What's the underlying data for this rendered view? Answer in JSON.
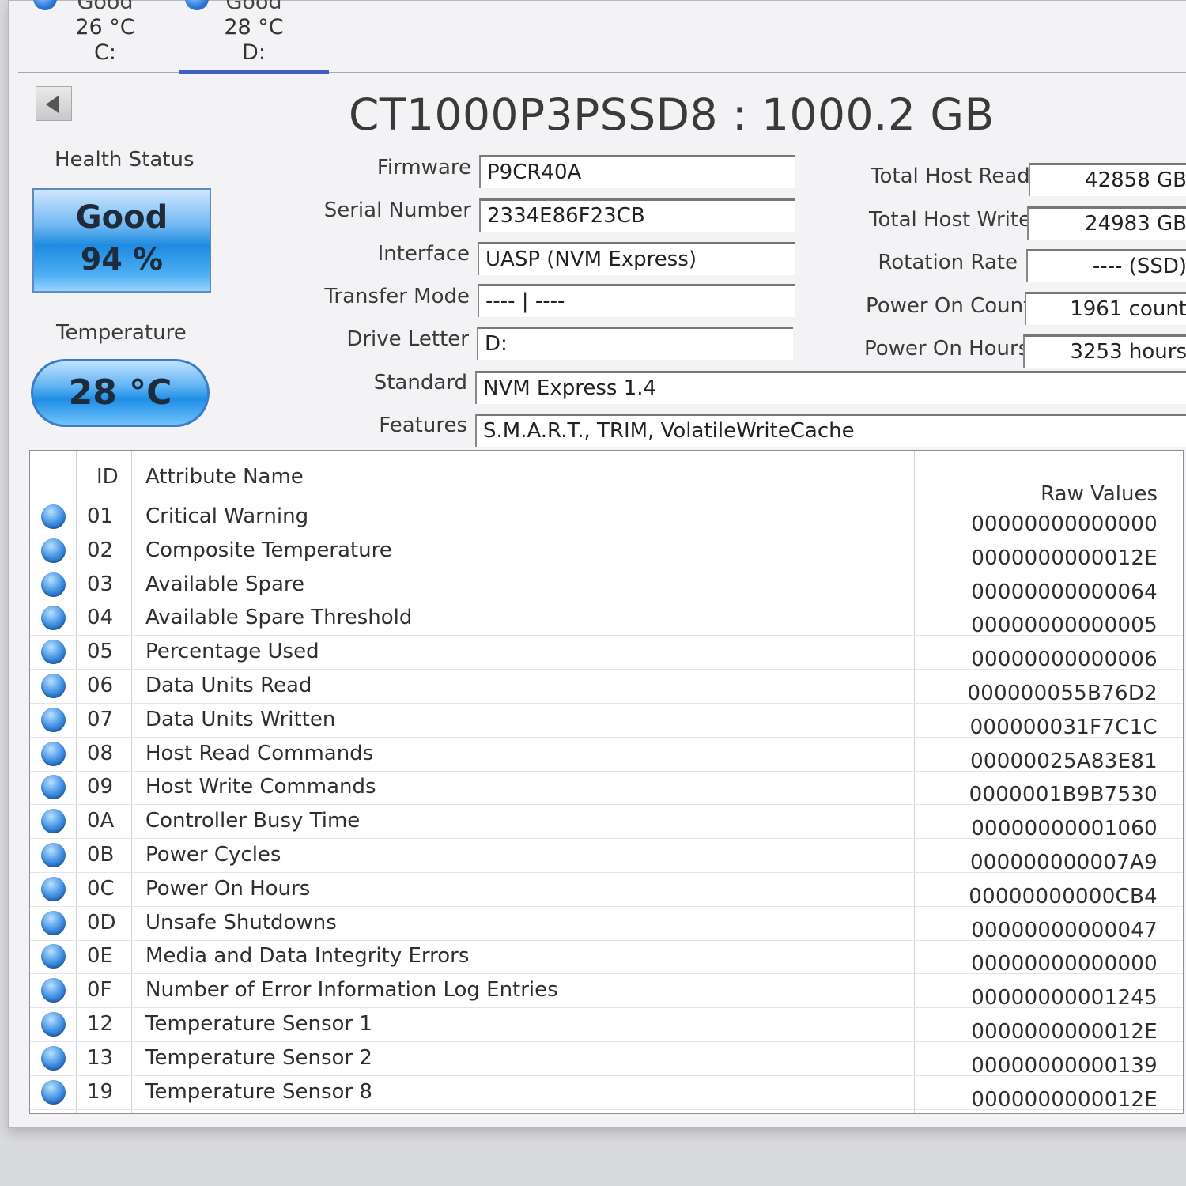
{
  "drive_tabs": [
    {
      "status": "Good",
      "temp": "26 °C",
      "letter": "C:"
    },
    {
      "status": "Good",
      "temp": "28 °C",
      "letter": "D:"
    }
  ],
  "title": "CT1000P3PSSD8 : 1000.2 GB",
  "health": {
    "label": "Health Status",
    "status": "Good",
    "percent": "94 %"
  },
  "temperature": {
    "label": "Temperature",
    "value": "28 °C"
  },
  "fields": {
    "firmware": {
      "label": "Firmware",
      "value": "P9CR40A"
    },
    "serial": {
      "label": "Serial Number",
      "value": "2334E86F23CB"
    },
    "interface": {
      "label": "Interface",
      "value": "UASP (NVM Express)"
    },
    "transfer": {
      "label": "Transfer Mode",
      "value": "---- | ----"
    },
    "drive_letter": {
      "label": "Drive Letter",
      "value": "D:"
    },
    "standard": {
      "label": "Standard",
      "value": "NVM Express 1.4"
    },
    "features": {
      "label": "Features",
      "value": "S.M.A.R.T., TRIM, VolatileWriteCache"
    }
  },
  "stats": {
    "host_reads": {
      "label": "Total Host Reads",
      "value": "42858 GB"
    },
    "host_writes": {
      "label": "Total Host Writes",
      "value": "24983 GB"
    },
    "rotation": {
      "label": "Rotation Rate",
      "value": "---- (SSD)"
    },
    "power_count": {
      "label": "Power On Count",
      "value": "1961 count"
    },
    "power_hours": {
      "label": "Power On Hours",
      "value": "3253 hours"
    }
  },
  "table": {
    "headers": {
      "id": "ID",
      "name": "Attribute Name",
      "raw": "Raw Values"
    },
    "rows": [
      {
        "id": "01",
        "name": "Critical Warning",
        "raw": "00000000000000"
      },
      {
        "id": "02",
        "name": "Composite Temperature",
        "raw": "0000000000012E"
      },
      {
        "id": "03",
        "name": "Available Spare",
        "raw": "00000000000064"
      },
      {
        "id": "04",
        "name": "Available Spare Threshold",
        "raw": "00000000000005"
      },
      {
        "id": "05",
        "name": "Percentage Used",
        "raw": "00000000000006"
      },
      {
        "id": "06",
        "name": "Data Units Read",
        "raw": "000000055B76D2"
      },
      {
        "id": "07",
        "name": "Data Units Written",
        "raw": "000000031F7C1C"
      },
      {
        "id": "08",
        "name": "Host Read Commands",
        "raw": "00000025A83E81"
      },
      {
        "id": "09",
        "name": "Host Write Commands",
        "raw": "0000001B9B7530"
      },
      {
        "id": "0A",
        "name": "Controller Busy Time",
        "raw": "00000000001060"
      },
      {
        "id": "0B",
        "name": "Power Cycles",
        "raw": "000000000007A9"
      },
      {
        "id": "0C",
        "name": "Power On Hours",
        "raw": "00000000000CB4"
      },
      {
        "id": "0D",
        "name": "Unsafe Shutdowns",
        "raw": "00000000000047"
      },
      {
        "id": "0E",
        "name": "Media and Data Integrity Errors",
        "raw": "00000000000000"
      },
      {
        "id": "0F",
        "name": "Number of Error Information Log Entries",
        "raw": "00000000001245"
      },
      {
        "id": "12",
        "name": "Temperature Sensor 1",
        "raw": "0000000000012E"
      },
      {
        "id": "13",
        "name": "Temperature Sensor 2",
        "raw": "00000000000139"
      },
      {
        "id": "19",
        "name": "Temperature Sensor 8",
        "raw": "0000000000012E"
      }
    ]
  }
}
